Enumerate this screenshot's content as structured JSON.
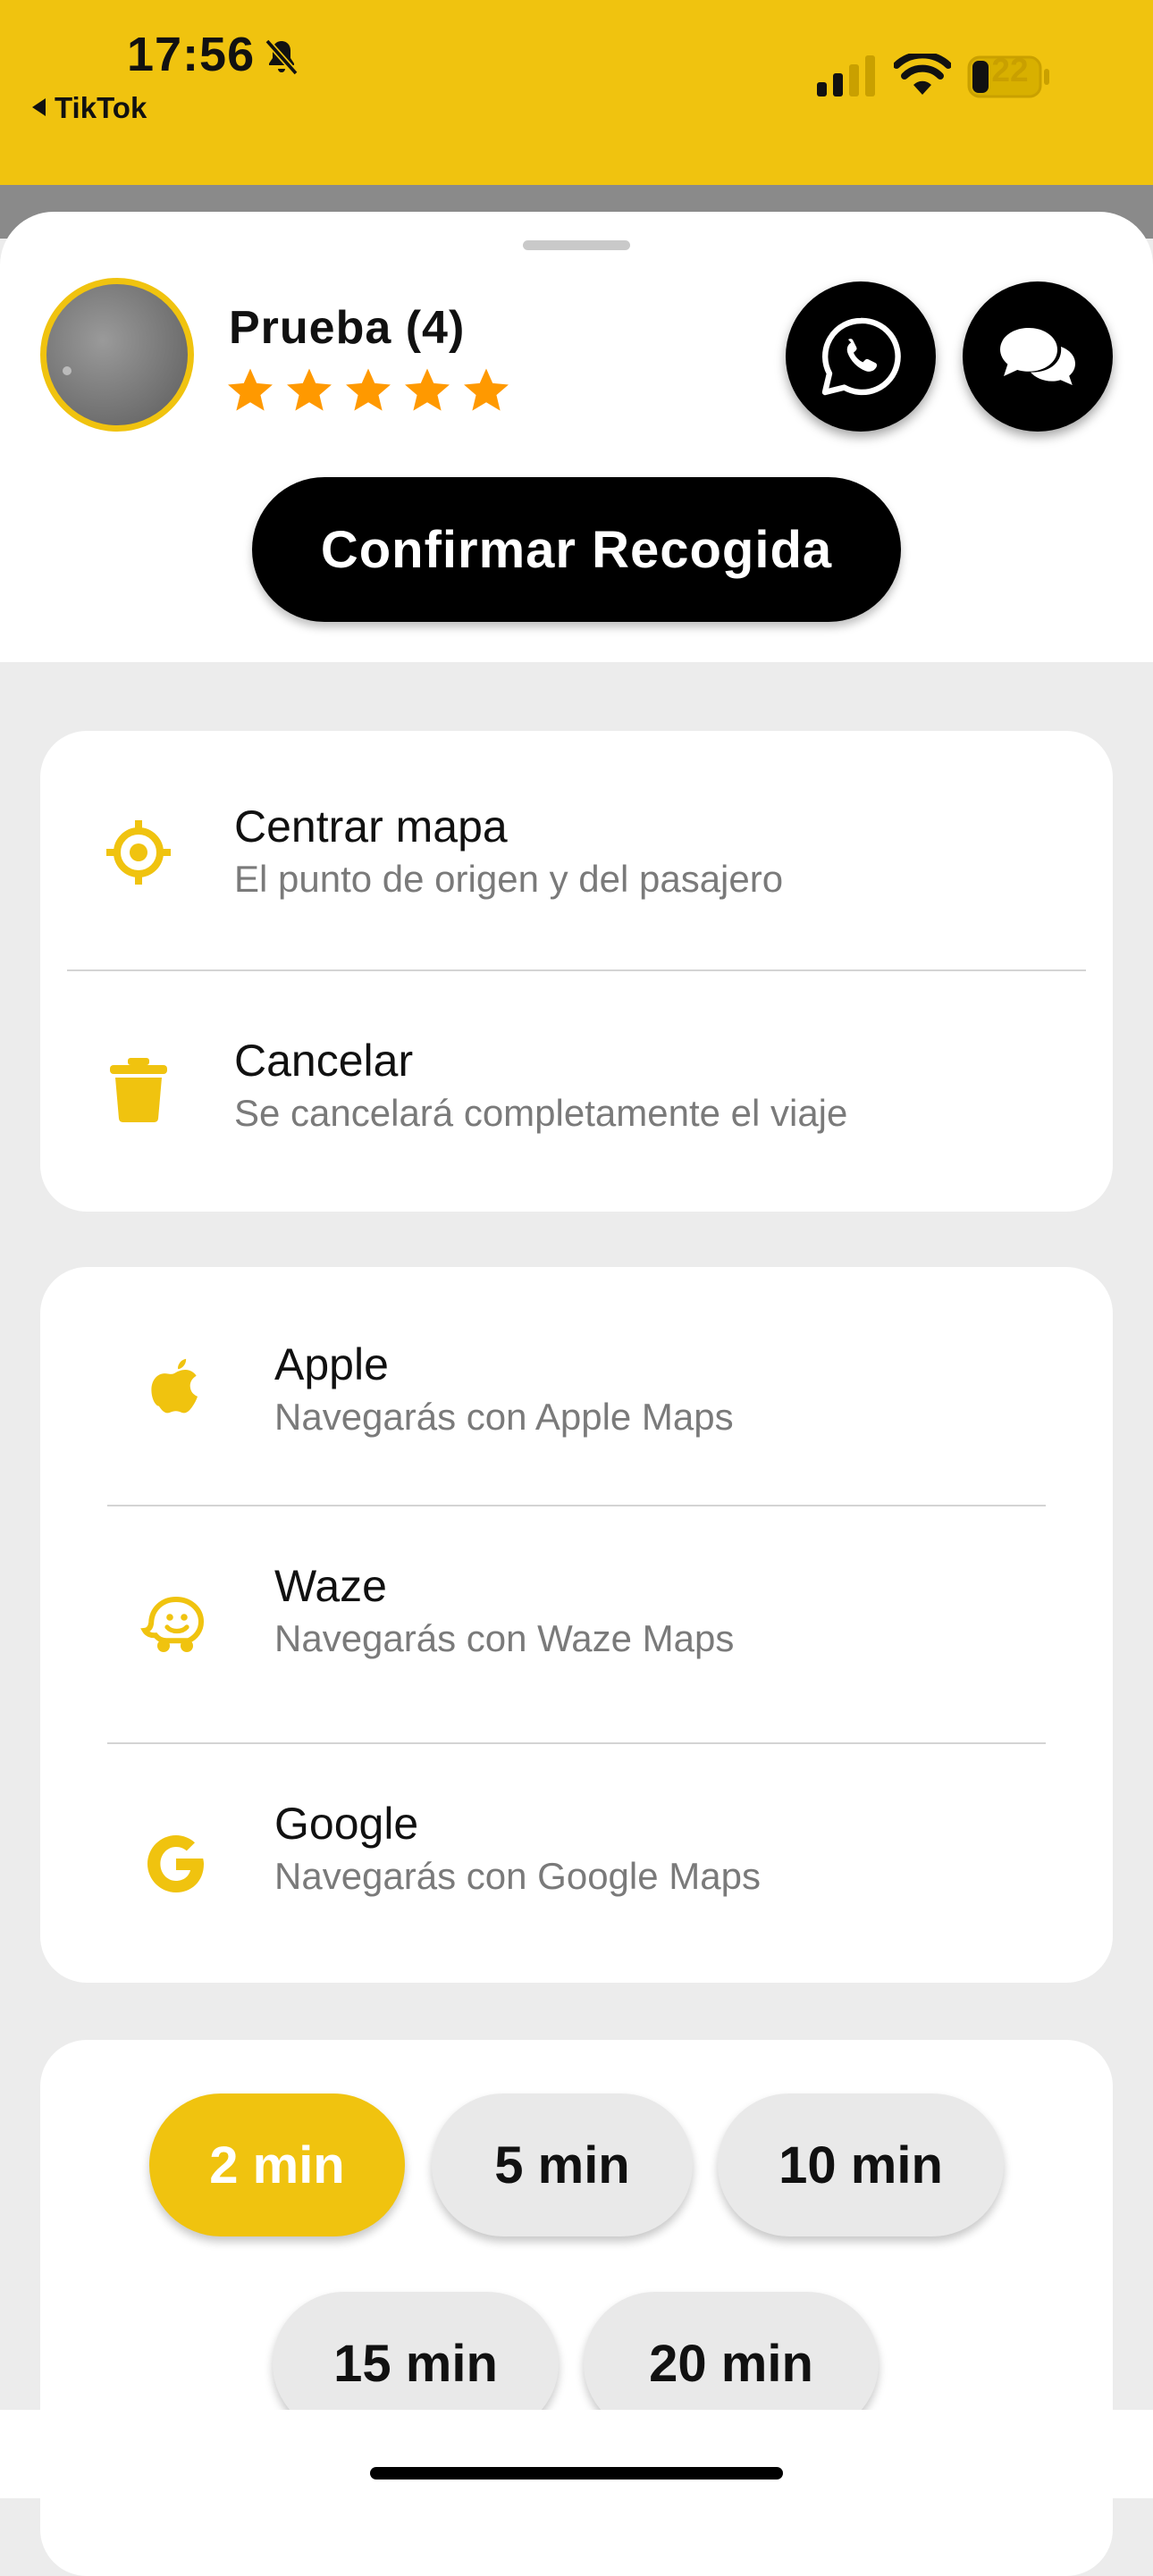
{
  "status_bar": {
    "time": "17:56",
    "back_app": "TikTok",
    "battery": "22",
    "icons": [
      "bell-slash-icon",
      "signal-icon",
      "wifi-icon",
      "battery-icon"
    ]
  },
  "driver": {
    "name": "Prueba (4)",
    "rating": 5,
    "rating_max": 5
  },
  "actions": {
    "whatsapp_icon": "whatsapp-icon",
    "chat_icon": "chat-bubbles-icon",
    "confirm_label": "Confirmar Recogida"
  },
  "options": [
    {
      "icon": "crosshair-icon",
      "title": "Centrar mapa",
      "subtitle": "El punto de origen y del pasajero"
    },
    {
      "icon": "trash-icon",
      "title": "Cancelar",
      "subtitle": "Se cancelará completamente el viaje"
    }
  ],
  "navigation": [
    {
      "icon": "apple-icon",
      "title": "Apple",
      "subtitle": "Navegarás con Apple Maps"
    },
    {
      "icon": "waze-icon",
      "title": "Waze",
      "subtitle": "Navegarás con Waze Maps"
    },
    {
      "icon": "google-icon",
      "title": "Google",
      "subtitle": "Navegarás con Google Maps"
    }
  ],
  "wait_times": {
    "selected": "2 min",
    "options": [
      "2 min",
      "5 min",
      "10 min",
      "15 min",
      "20 min"
    ]
  },
  "colors": {
    "accent": "#f0c30f",
    "star": "#ff9900",
    "primary_button": "#000000",
    "chip_inactive": "#e9e9e9"
  }
}
